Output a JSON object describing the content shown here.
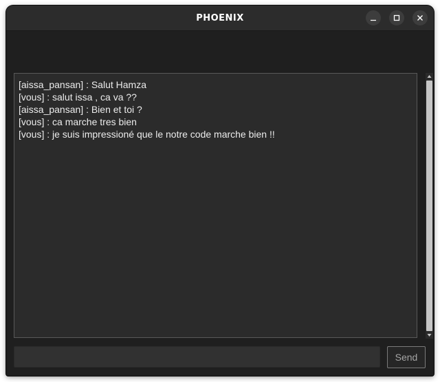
{
  "window": {
    "title": "PHOENIX",
    "controls": {
      "minimize_icon": "minimize-icon",
      "maximize_icon": "maximize-icon",
      "close_icon": "close-icon"
    }
  },
  "chat": {
    "messages": [
      "[aissa_pansan] : Salut Hamza",
      "[vous] : salut issa , ca va ??",
      "[aissa_pansan] : Bien et toi ?",
      "[vous] : ca marche tres bien",
      "[vous] : je suis impressioné que le notre code marche bien !!"
    ]
  },
  "composer": {
    "input_value": "",
    "send_label": "Send"
  },
  "colors": {
    "window_bg": "#1f1f1f",
    "titlebar_bg": "#2c2c2c",
    "chat_bg": "#2b2b2b",
    "text": "#ececec",
    "scroll_thumb": "#c6c6c6"
  }
}
